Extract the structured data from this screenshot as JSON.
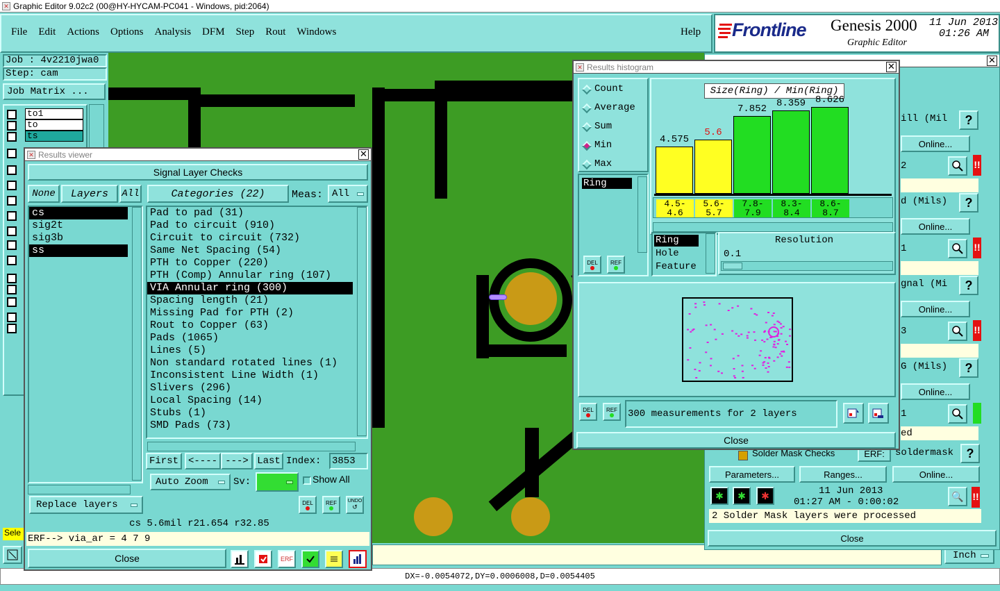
{
  "window_title": "Graphic Editor 9.02c2 (00@HY-HYCAM-PC041 - Windows, pid:2064)",
  "menu": [
    "File",
    "Edit",
    "Actions",
    "Options",
    "Analysis",
    "DFM",
    "Step",
    "Rout",
    "Windows"
  ],
  "help_label": "Help",
  "brand": {
    "logo": "Frontline",
    "product": "Genesis 2000",
    "subtitle": "Graphic Editor",
    "date": "11 Jun 2013",
    "time": "01:26 AM"
  },
  "job": {
    "job_label": "Job : 4v2210jwa0",
    "step_label": "Step: cam",
    "matrix_button": "Job Matrix ..."
  },
  "layer_panel": [
    {
      "name": "to1",
      "style": "white"
    },
    {
      "name": "to",
      "style": "white"
    },
    {
      "name": "ts",
      "style": "teal"
    }
  ],
  "results_viewer": {
    "title": "Results viewer",
    "header": "Signal Layer Checks",
    "none_label": "None",
    "layers_label": "Layers",
    "all_label": "All",
    "categories_label": "Categories (22)",
    "meas_label": "Meas:",
    "meas_value": "All",
    "layers": [
      {
        "name": "cs",
        "selected": true
      },
      {
        "name": "sig2t",
        "selected": false
      },
      {
        "name": "sig3b",
        "selected": false
      },
      {
        "name": "ss",
        "selected": true
      }
    ],
    "categories": [
      {
        "label": "Pad to pad (31)",
        "selected": false
      },
      {
        "label": "Pad to circuit (910)",
        "selected": false
      },
      {
        "label": "Circuit to circuit (732)",
        "selected": false
      },
      {
        "label": "Same Net Spacing (54)",
        "selected": false
      },
      {
        "label": "PTH to Copper (220)",
        "selected": false
      },
      {
        "label": "PTH (Comp) Annular ring (107)",
        "selected": false
      },
      {
        "label": "VIA Annular ring (300)",
        "selected": true
      },
      {
        "label": "Spacing length (21)",
        "selected": false
      },
      {
        "label": "Missing Pad for PTH (2)",
        "selected": false
      },
      {
        "label": "Rout to Copper (63)",
        "selected": false
      },
      {
        "label": "Pads (1065)",
        "selected": false
      },
      {
        "label": "Lines (5)",
        "selected": false
      },
      {
        "label": "Non standard rotated lines (1)",
        "selected": false
      },
      {
        "label": "Inconsistent Line Width (1)",
        "selected": false
      },
      {
        "label": "Slivers (296)",
        "selected": false
      },
      {
        "label": "Local Spacing (14)",
        "selected": false
      },
      {
        "label": "Stubs (1)",
        "selected": false
      },
      {
        "label": "SMD Pads (73)",
        "selected": false
      }
    ],
    "nav": {
      "first": "First",
      "prev": "<----",
      "next": "--->",
      "last": "Last",
      "index_label": "Index:",
      "index_value": "3853"
    },
    "auto_zoom": "Auto Zoom",
    "sv_label": "Sv:",
    "show_all": "Show All",
    "replace_layers": "Replace layers",
    "del": "DEL",
    "ref": "REF",
    "undo": "UNDO",
    "status": "cs 5.6mil  r21.654  r32.85",
    "erf_line": "ERF--> via_ar = 4 7 9",
    "close": "Close"
  },
  "histogram": {
    "title": "Results histogram",
    "modes": [
      {
        "label": "Count",
        "on": false
      },
      {
        "label": "Average",
        "on": false
      },
      {
        "label": "Sum",
        "on": false
      },
      {
        "label": "Min",
        "on": true
      },
      {
        "label": "Max",
        "on": false
      }
    ],
    "chart_title": "Size(Ring) / Min(Ring)",
    "bars": [
      {
        "value": "4.575",
        "height_pct": 0.52,
        "color": "#ffff22",
        "label_color": "#000",
        "range": "4.5-\n4.6"
      },
      {
        "value": "5.6",
        "height_pct": 0.6,
        "color": "#ffff22",
        "label_color": "#dd1111",
        "range": "5.6-\n5.7"
      },
      {
        "value": "7.852",
        "height_pct": 0.86,
        "color": "#22dd22",
        "label_color": "#000",
        "range": "7.8-\n7.9"
      },
      {
        "value": "8.359",
        "height_pct": 0.92,
        "color": "#22dd22",
        "label_color": "#000",
        "range": "8.3-\n8.4"
      },
      {
        "value": "8.626",
        "height_pct": 0.96,
        "color": "#22dd22",
        "label_color": "#000",
        "range": "8.6-\n8.7"
      }
    ],
    "list_item": "Ring",
    "res_items": [
      "Ring",
      "Hole",
      "Feature"
    ],
    "resolution_label": "Resolution",
    "resolution_value": "0.1",
    "measurements": "300 measurements for 2 layers",
    "del": "DEL",
    "ref": "REF",
    "close": "Close"
  },
  "checks_panel": {
    "rows": [
      {
        "title": "ill (Mil",
        "online": "Online...",
        "val": "2",
        "status": "red"
      },
      {
        "title": "d (Mils)",
        "online": "Online...",
        "val": "1",
        "status": "red"
      },
      {
        "title": "gnal (Mi",
        "online": "Online...",
        "val": "3",
        "status": "red"
      },
      {
        "title": "G (Mils)",
        "online": "Online...",
        "val": "1",
        "status": "green",
        "extra": "ed"
      }
    ],
    "solder_title": "Solder Mask Checks",
    "erf_label": "ERF:",
    "erf_value": "soldermask",
    "parameters": "Parameters...",
    "ranges": "Ranges...",
    "online": "Online...",
    "date": "11 Jun 2013",
    "time": "01:27 AM - 0:00:02",
    "message": "2 Solder Mask layers were processed",
    "close": "Close"
  },
  "units": "Inch",
  "coords": "DX=-0.0054072,DY=0.0006008,D=0.0054405",
  "sele_label": "Sele",
  "help_q": "?",
  "alert": "!!"
}
